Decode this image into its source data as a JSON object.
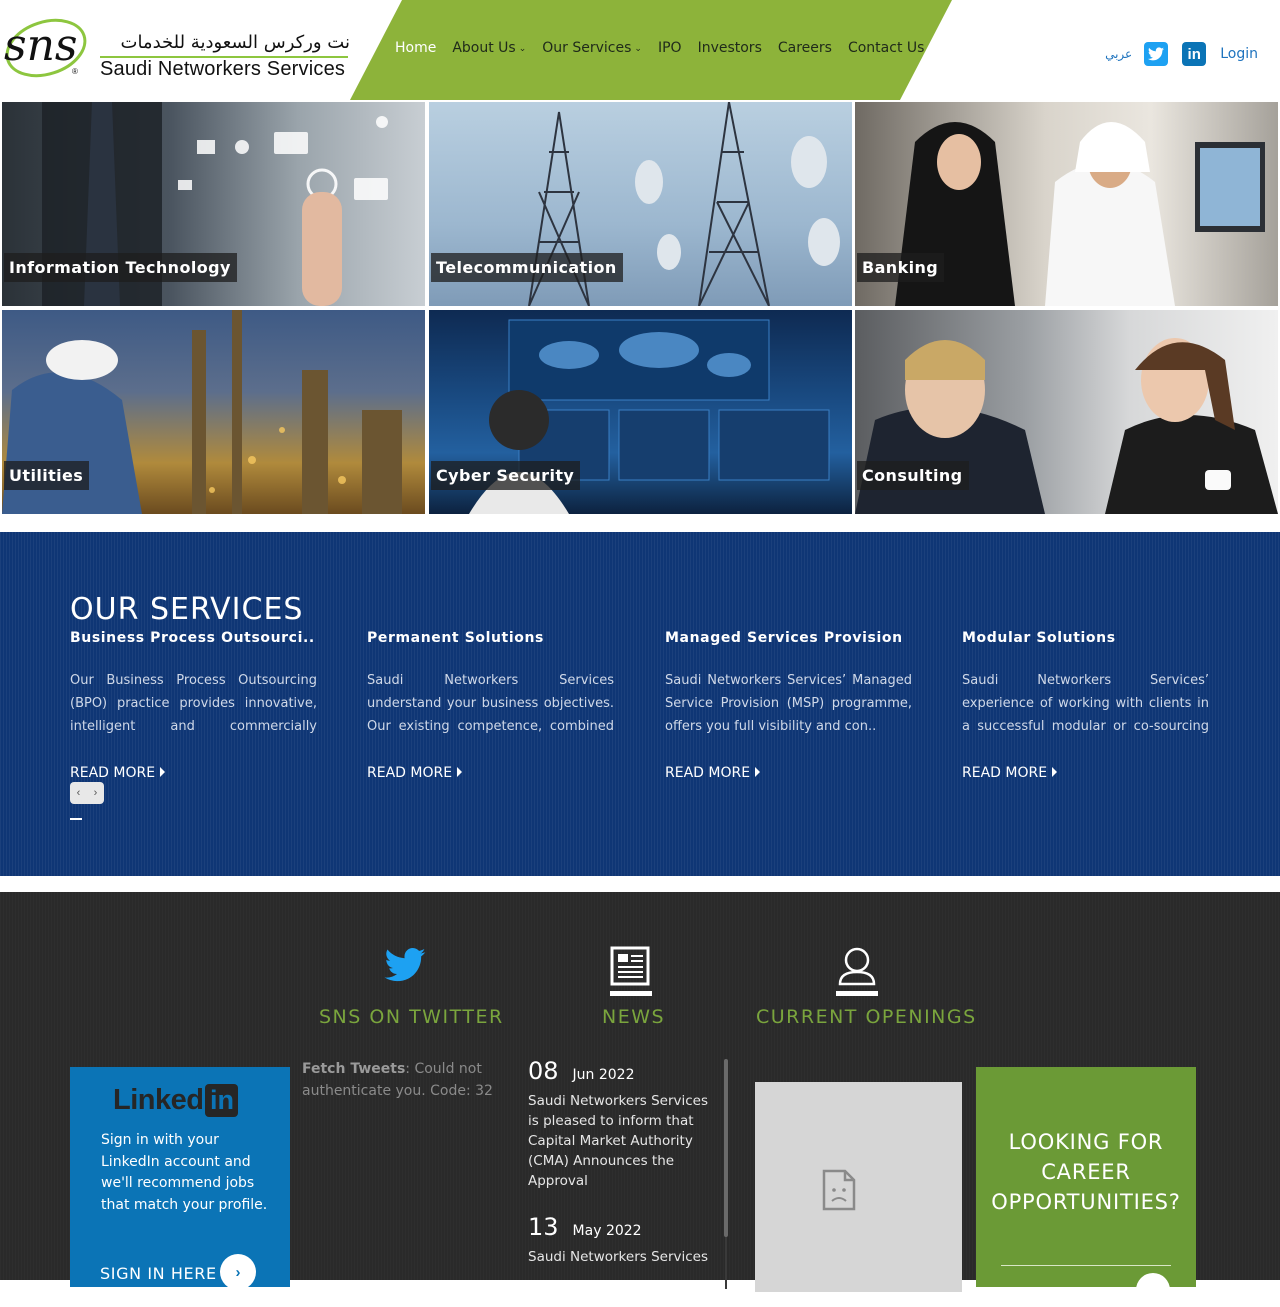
{
  "brand": {
    "logo_mark": "sns",
    "arabic_name": "نت وركرس السعودية للخدمات",
    "english_name": "Saudi Networkers Services",
    "accent_green": "#8db33a",
    "brand_blue": "#0f3675"
  },
  "nav": {
    "items": [
      {
        "label": "Home",
        "active": true
      },
      {
        "label": "About Us",
        "dropdown": true
      },
      {
        "label": "Our Services",
        "dropdown": true
      },
      {
        "label": "IPO"
      },
      {
        "label": "Investors"
      },
      {
        "label": "Careers"
      },
      {
        "label": "Contact Us"
      }
    ],
    "language": "عربي",
    "login": "Login",
    "social": [
      "twitter-icon",
      "linkedin-icon"
    ]
  },
  "tiles": [
    {
      "label": "Information Technology"
    },
    {
      "label": "Telecommunication"
    },
    {
      "label": "Banking"
    },
    {
      "label": "Utilities"
    },
    {
      "label": "Cyber Security"
    },
    {
      "label": "Consulting"
    }
  ],
  "services": {
    "title": "OUR SERVICES",
    "items": [
      {
        "title": "Business Process Outsourci..",
        "text": "Our Business Process Outsourcing (BPO) practice provides innovative, intelligent and commercially simple....",
        "cta": "READ MORE"
      },
      {
        "title": "Permanent Solutions",
        "text": "Saudi Networkers Services understand your business objectives. Our existing competence, combined with reso..",
        "cta": "READ MORE"
      },
      {
        "title": "Managed Services Provision",
        "text": "Saudi Networkers Services’ Managed Service Provision (MSP) programme, offers you full visibility and con..",
        "cta": "READ MORE"
      },
      {
        "title": "Modular Solutions",
        "text": "Saudi Networkers Services’ experience of working with clients in a successful modular or co-sourcing par..",
        "cta": "READ MORE"
      }
    ],
    "pager": {
      "prev": "‹",
      "next": "›"
    }
  },
  "bottom": {
    "twitter_heading": "SNS ON TWITTER",
    "news_heading": "NEWS",
    "openings_heading": "CURRENT OPENINGS",
    "linkedin": {
      "word": "Linked",
      "box": "in",
      "text": "Sign in with your LinkedIn account and we'll recommend jobs that match your profile.",
      "cta": "SIGN IN HERE"
    },
    "tweets": {
      "label": "Fetch Tweets",
      "message": ": Could not authenticate you. Code: 32"
    },
    "news": [
      {
        "day": "08",
        "month": "Jun 2022",
        "text": "Saudi Networkers Services is pleased to inform that Capital Market Authority (CMA) Announces the Approval"
      },
      {
        "day": "13",
        "month": "May 2022",
        "text": "Saudi Networkers Services"
      }
    ],
    "career": {
      "text": "LOOKING FOR CAREER OPPORTUNITIES?"
    }
  }
}
